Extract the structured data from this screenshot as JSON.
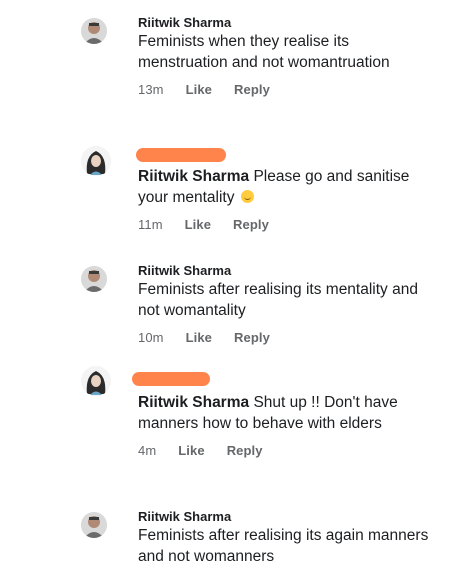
{
  "comments": [
    {
      "author": "Riitwik Sharma",
      "text": "Feminists when they realise its menstruation and not womantruation",
      "time": "13m",
      "like": "Like",
      "reply": "Reply"
    },
    {
      "author": "Riitwik Sharma",
      "text": "Please go and sanitise your mentality",
      "time": "11m",
      "like": "Like",
      "reply": "Reply",
      "emoji": "smiling-face-icon"
    },
    {
      "author": "Riitwik Sharma",
      "text": "Feminists after realising its mentality and not womantality",
      "time": "10m",
      "like": "Like",
      "reply": "Reply"
    },
    {
      "author": "Riitwik Sharma",
      "text": "Shut up !! Don't have manners how to behave with elders",
      "time": "4m",
      "like": "Like",
      "reply": "Reply"
    },
    {
      "author": "Riitwik Sharma",
      "text": "Feminists after realising its again manners and not womanners"
    }
  ],
  "colors": {
    "redaction": "#ff7a3d",
    "meta_text": "#65676b"
  }
}
